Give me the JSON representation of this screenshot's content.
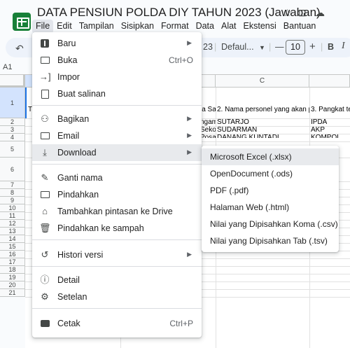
{
  "app": {
    "title": "DATA PENSIUN POLDA DIY TAHUN 2023 (Jawaban)",
    "title_icons": [
      "star-icon",
      "move-folder-icon",
      "cloud-status-icon"
    ]
  },
  "menubar": [
    "File",
    "Edit",
    "Tampilan",
    "Sisipkan",
    "Format",
    "Data",
    "Alat",
    "Ekstensi",
    "Bantuan"
  ],
  "toolbar": {
    "zoom_partial": "23",
    "font": "Defaul...",
    "minus": "—",
    "font_size": "10",
    "plus": "+",
    "bold": "B",
    "italic": "I"
  },
  "namebox": "A1",
  "columns": {
    "c": "C"
  },
  "rows": [
    "1",
    "2",
    "3",
    "4",
    "5",
    "6",
    "7",
    "8",
    "9",
    "10",
    "11",
    "12",
    "13",
    "14",
    "15",
    "16",
    "17",
    "18",
    "19",
    "20",
    "21"
  ],
  "cells": {
    "row1_a": "T",
    "row1_b": "la Sa",
    "row1_c": "2. Nama personel yang akan p",
    "row1_d": "3. Pangkat te",
    "r2_b": "ngam",
    "r2_c": "SUTARJO",
    "r2_d": "IPDA",
    "r3_b": "Sekol",
    "r3_c": "SUDARMAN",
    "r3_d": "AKP",
    "r4_b": "Posal",
    "r4_c": "DANANG KUNTADI",
    "r4_d": "KOMPOL"
  },
  "file_menu": {
    "items": [
      {
        "icon": "new-sheet-icon",
        "label": "Baru",
        "shortcut": "",
        "submenu": true
      },
      {
        "icon": "open-folder-icon",
        "label": "Buka",
        "shortcut": "Ctrl+O",
        "submenu": false
      },
      {
        "icon": "import-icon",
        "label": "Impor",
        "shortcut": "",
        "submenu": false
      },
      {
        "icon": "copy-icon",
        "label": "Buat salinan",
        "shortcut": "",
        "submenu": false
      },
      {
        "icon": "share-icon",
        "label": "Bagikan",
        "shortcut": "",
        "submenu": true
      },
      {
        "icon": "email-icon",
        "label": "Email",
        "shortcut": "",
        "submenu": true
      },
      {
        "icon": "download-icon",
        "label": "Download",
        "shortcut": "",
        "submenu": true
      },
      {
        "icon": "rename-icon",
        "label": "Ganti nama",
        "shortcut": "",
        "submenu": false
      },
      {
        "icon": "move-icon",
        "label": "Pindahkan",
        "shortcut": "",
        "submenu": false
      },
      {
        "icon": "drive-shortcut-icon",
        "label": "Tambahkan pintasan ke Drive",
        "shortcut": "",
        "submenu": false
      },
      {
        "icon": "trash-icon",
        "label": "Pindahkan ke sampah",
        "shortcut": "",
        "submenu": false
      },
      {
        "icon": "history-icon",
        "label": "Histori versi",
        "shortcut": "",
        "submenu": true
      },
      {
        "icon": "info-icon",
        "label": "Detail",
        "shortcut": "",
        "submenu": false
      },
      {
        "icon": "settings-icon",
        "label": "Setelan",
        "shortcut": "",
        "submenu": false
      },
      {
        "icon": "print-icon",
        "label": "Cetak",
        "shortcut": "Ctrl+P",
        "submenu": false
      }
    ]
  },
  "download_submenu": {
    "items": [
      "Microsoft Excel (.xlsx)",
      "OpenDocument (.ods)",
      "PDF (.pdf)",
      "Halaman Web (.html)",
      "Nilai yang Dipisahkan Koma (.csv)",
      "Nilai yang Dipisahkan Tab (.tsv)"
    ]
  },
  "colors": {
    "brand_green": "#188038",
    "selection_blue": "#1a73e8",
    "hover_gray": "#e8eaed"
  }
}
